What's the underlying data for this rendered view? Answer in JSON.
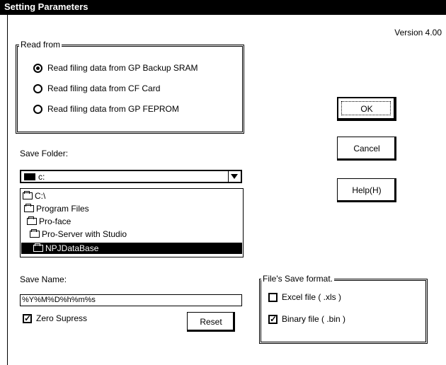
{
  "window": {
    "title": "Setting Parameters",
    "version": "Version 4.00"
  },
  "read_from": {
    "legend": "Read from",
    "options": [
      {
        "label": "Read filing data from GP Backup SRAM",
        "selected": true
      },
      {
        "label": "Read filing data from CF Card",
        "selected": false
      },
      {
        "label": "Read filing data from GP FEPROM",
        "selected": false
      }
    ]
  },
  "buttons": {
    "ok": "OK",
    "cancel": "Cancel",
    "help": "Help(H)"
  },
  "save_folder": {
    "label": "Save Folder:",
    "drive": "c:",
    "folders": [
      {
        "name": "C:\\",
        "selected": false
      },
      {
        "name": "Program Files",
        "selected": false
      },
      {
        "name": "Pro-face",
        "selected": false
      },
      {
        "name": "Pro-Server with Studio",
        "selected": false
      },
      {
        "name": "NPJDataBase",
        "selected": true
      }
    ]
  },
  "save_name": {
    "label": "Save Name:",
    "value": "%Y%M%D%h%m%s"
  },
  "zero_supress": {
    "label": "Zero Supress",
    "checked": true
  },
  "reset_label": "Reset",
  "save_format": {
    "legend": "File's Save format.",
    "excel": {
      "label": "Excel file ( .xls )",
      "checked": false
    },
    "binary": {
      "label": "Binary file ( .bin )",
      "checked": true
    }
  }
}
